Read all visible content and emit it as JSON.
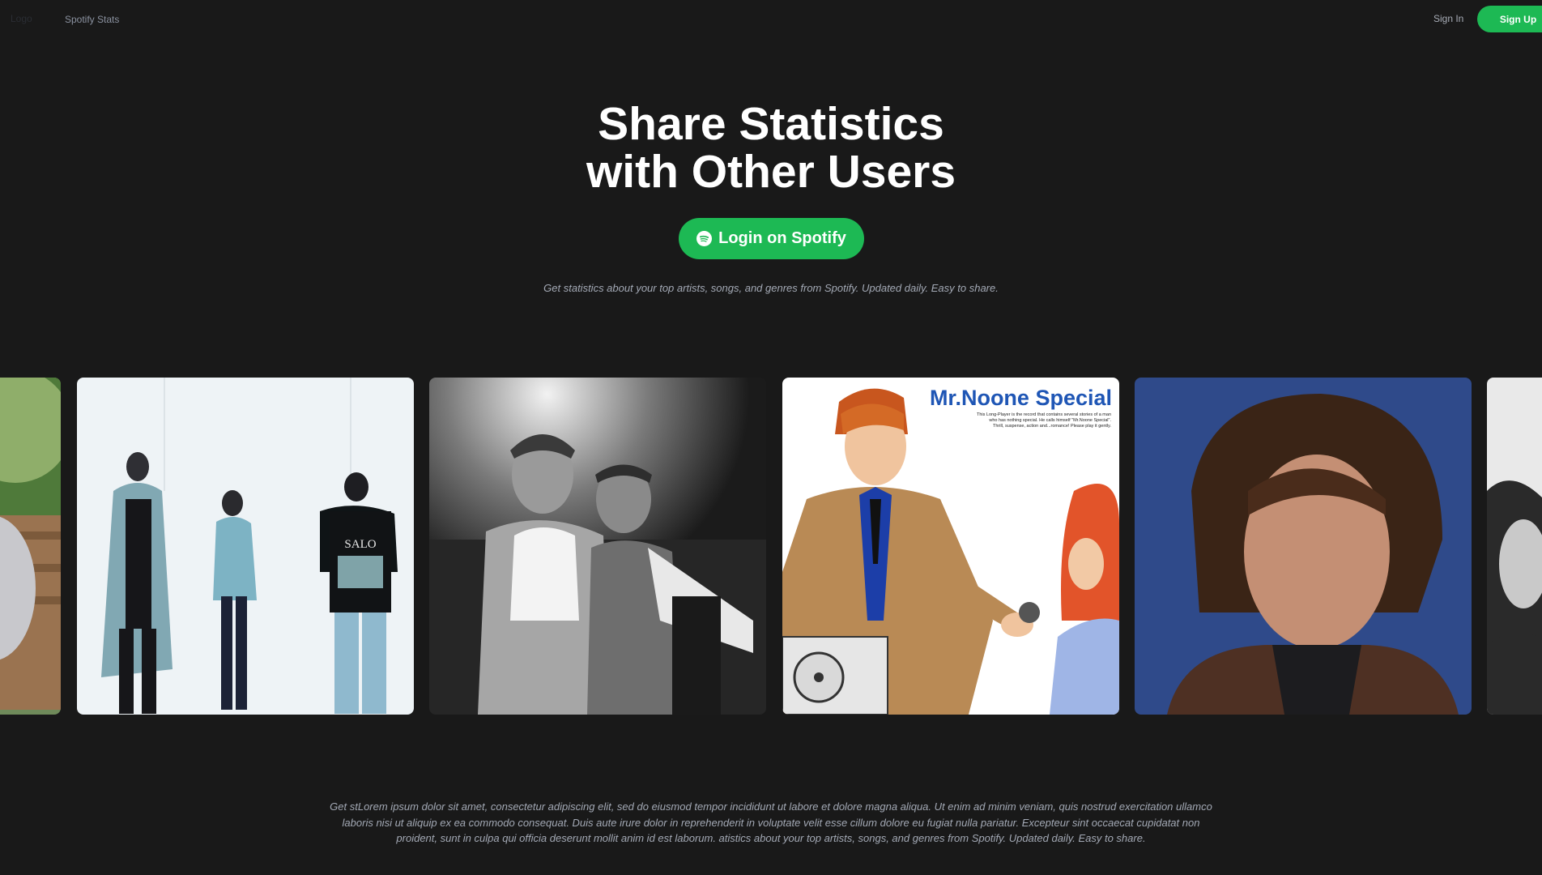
{
  "nav": {
    "logo": "Logo",
    "brand_link": "Spotify Stats",
    "sign_in": "Sign In",
    "sign_up": "Sign Up"
  },
  "hero": {
    "title_line1": "Share Statistics",
    "title_line2": "with Other Users",
    "cta_label": "Login on Spotify",
    "subtitle": "Get statistics about your top artists, songs, and genres from Spotify. Updated daily. Easy to share."
  },
  "gallery": {
    "album_title": "Mr.Noone Special",
    "album_blurb_1": "This Long-Player is the record that contains several stories of a man",
    "album_blurb_2": "who has nothing special. He calls himself \"Mr.Noone Special\".",
    "album_blurb_3": "Thrill, suspense, action and...romance! Please play it gently.",
    "shirt_text": "SALO"
  },
  "footer": {
    "body": "Get stLorem ipsum dolor sit amet, consectetur adipiscing elit, sed do eiusmod tempor incididunt ut labore et dolore magna aliqua. Ut enim ad minim veniam, quis nostrud exercitation ullamco laboris nisi ut aliquip ex ea commodo consequat. Duis aute irure dolor in reprehenderit in voluptate velit esse cillum dolore eu fugiat nulla pariatur. Excepteur sint occaecat cupidatat non proident, sunt in culpa qui officia deserunt mollit anim id est laborum. atistics about your top artists, songs, and genres from Spotify. Updated daily. Easy to share."
  },
  "colors": {
    "background": "#191919",
    "accent": "#1db954",
    "muted_text": "#a3a9b5"
  }
}
